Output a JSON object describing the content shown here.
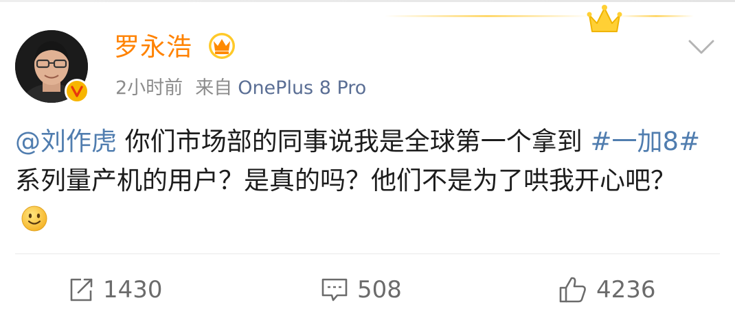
{
  "post": {
    "author_name": "罗永浩",
    "time_ago": "2小时前",
    "source_label": "来自",
    "source_device": "OnePlus 8 Pro",
    "content": {
      "mention": "@刘作虎",
      "text_1": " 你们市场部的同事说我是全球第一个拿到 ",
      "hashtag": "#一加8#",
      "text_2": " 系列量产机的用户？是真的吗？他们不是为了哄我开心吧？",
      "emoji": "smile-emoji"
    }
  },
  "actions": {
    "repost_count": "1430",
    "comment_count": "508",
    "like_count": "4236"
  },
  "icons": {
    "verified": "verified-v-badge-icon",
    "vip": "vip-crown-icon",
    "menu": "chevron-down-icon",
    "repost": "repost-icon",
    "comment": "comment-icon",
    "like": "thumbs-up-icon"
  },
  "colors": {
    "author": "#ff8200",
    "link": "#507daf",
    "device": "#5a6e94",
    "meta": "#8c8c8c",
    "text": "#1c1c1c",
    "actions": "#6b6b6b"
  }
}
